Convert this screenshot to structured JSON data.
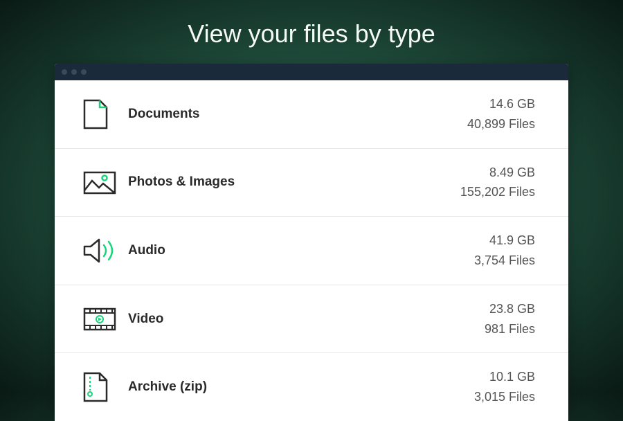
{
  "heading": "View your files by type",
  "categories": [
    {
      "icon": "document-icon",
      "label": "Documents",
      "size": "14.6 GB",
      "files": "40,899 Files"
    },
    {
      "icon": "photos-icon",
      "label": "Photos & Images",
      "size": "8.49 GB",
      "files": "155,202 Files"
    },
    {
      "icon": "audio-icon",
      "label": "Audio",
      "size": "41.9 GB",
      "files": "3,754 Files"
    },
    {
      "icon": "video-icon",
      "label": "Video",
      "size": "23.8 GB",
      "files": "981 Files"
    },
    {
      "icon": "archive-icon",
      "label": "Archive (zip)",
      "size": "10.1 GB",
      "files": "3,015 Files"
    }
  ]
}
